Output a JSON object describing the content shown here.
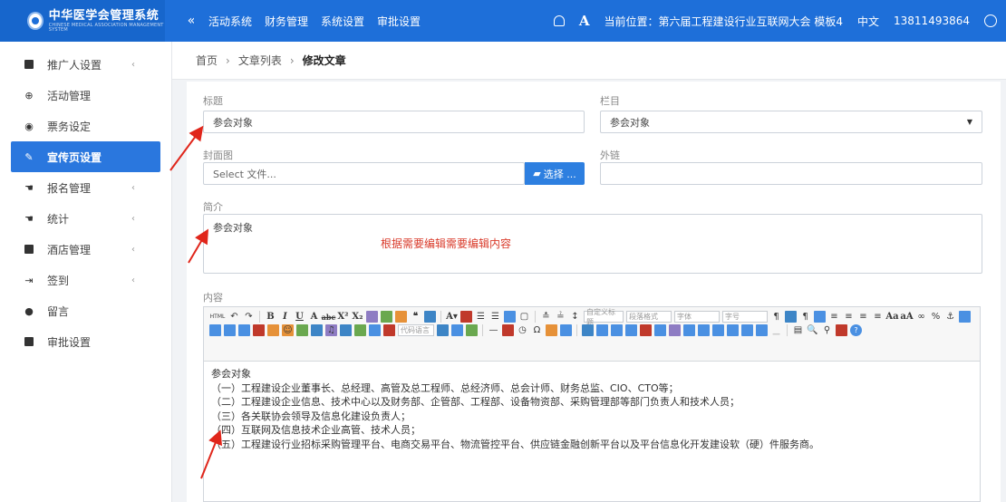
{
  "brand": {
    "name": "中华医学会管理系统",
    "subtitle": "CHINESE MEDICAL ASSOCIATION MANAGEMENT SYSTEM"
  },
  "topnav": {
    "collapse": "«",
    "items": [
      "活动系统",
      "财务管理",
      "系统设置",
      "审批设置"
    ]
  },
  "topright": {
    "font_icon_label": "A",
    "location": "当前位置：第六届工程建设行业互联网大会 模板4",
    "language": "中文",
    "phone": "13811493864"
  },
  "sidebar": {
    "items": [
      {
        "label": "推广人设置",
        "icon": "square-icon",
        "arrow": "‹"
      },
      {
        "label": "活动管理",
        "icon": "globe-icon",
        "arrow": ""
      },
      {
        "label": "票务设定",
        "icon": "target-icon",
        "arrow": ""
      },
      {
        "label": "宣传页设置",
        "icon": "pen-icon",
        "arrow": "",
        "active": true
      },
      {
        "label": "报名管理",
        "icon": "thumb-icon",
        "arrow": "‹"
      },
      {
        "label": "统计",
        "icon": "thumb-icon",
        "arrow": "‹"
      },
      {
        "label": "酒店管理",
        "icon": "square-icon",
        "arrow": "‹"
      },
      {
        "label": "签到",
        "icon": "signin-icon",
        "arrow": "‹"
      },
      {
        "label": "留言",
        "icon": "chat-icon",
        "arrow": ""
      },
      {
        "label": "审批设置",
        "icon": "square-icon",
        "arrow": ""
      }
    ]
  },
  "breadcrumb": {
    "home": "首页",
    "list": "文章列表",
    "current": "修改文章",
    "sep": "›"
  },
  "form": {
    "title_label": "标题",
    "title_value": "参会对象",
    "column_label": "栏目",
    "column_value": "参会对象",
    "cover_label": "封面图",
    "cover_placeholder": "Select 文件...",
    "choose_button": "选择 ...",
    "link_label": "外链",
    "link_value": "",
    "summary_label": "简介",
    "summary_value": "参会对象",
    "annotation": "根据需要编辑需要编辑内容",
    "content_label": "内容"
  },
  "toolbar": {
    "html_label": "HTML",
    "selects": [
      "自定义标题",
      "段落格式",
      "字体",
      "字号",
      "代码语言"
    ]
  },
  "content_lines": [
    "参会对象",
    "（一）工程建设企业董事长、总经理、高管及总工程师、总经济师、总会计师、财务总监、CIO、CTO等；",
    "（二）工程建设企业信息、技术中心以及财务部、企管部、工程部、设备物资部、采购管理部等部门负责人和技术人员；",
    "（三）各关联协会领导及信息化建设负责人；",
    "（四）互联网及信息技术企业高管、技术人员；",
    "（五）工程建设行业招标采购管理平台、电商交易平台、物流管控平台、供应链金融创新平台以及平台信息化开发建设软（硬）件服务商。"
  ],
  "colors": {
    "primary": "#1e6fd9",
    "active": "#2a77de",
    "annotation": "#d93a2a"
  }
}
